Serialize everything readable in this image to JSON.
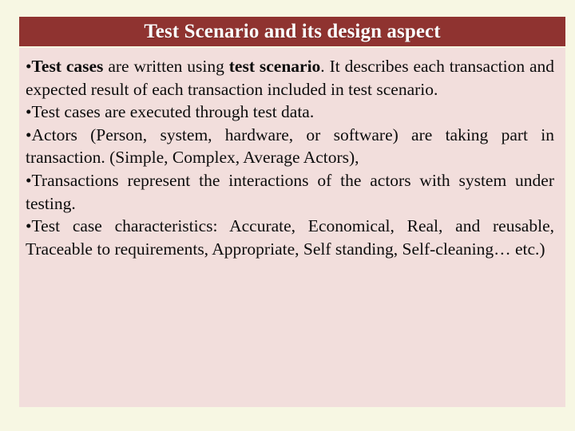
{
  "slide": {
    "background_color": "#f7f7e3",
    "title": {
      "text": "Test Scenario and its design aspect",
      "background_color": "#8f3330",
      "text_color": "#ffffff"
    },
    "content": {
      "background_color": "#f2dedc",
      "bullets": [
        {
          "id": "bullet-test-cases-written",
          "segments": [
            {
              "text": "Test cases",
              "bold": true
            },
            {
              "text": " are written using ",
              "bold": false
            },
            {
              "text": "test scenario",
              "bold": true
            },
            {
              "text": ". It describes each transaction and expected result of each transaction included in test scenario.",
              "bold": false
            }
          ],
          "plain": "Test cases are written using test scenario. It describes each transaction and expected result of each transaction included in test scenario."
        },
        {
          "id": "bullet-test-cases-executed",
          "segments": [
            {
              "text": "Test cases are executed through test data.",
              "bold": false
            }
          ],
          "plain": "Test cases are executed through test data."
        },
        {
          "id": "bullet-actors",
          "segments": [
            {
              "text": "Actors (Person, system, hardware, or software) are taking part in transaction. (Simple, Complex, Average Actors),",
              "bold": false
            }
          ],
          "plain": "Actors (Person, system, hardware, or software) are taking part in transaction. (Simple, Complex, Average Actors),"
        },
        {
          "id": "bullet-transactions",
          "segments": [
            {
              "text": "Transactions represent the interactions of the actors with system under testing.",
              "bold": false
            }
          ],
          "plain": "Transactions represent the interactions of the actors with system under testing."
        },
        {
          "id": "bullet-test-case-characteristics",
          "segments": [
            {
              "text": "Test case characteristics: Accurate, Economical, Real, and reusable, Traceable to requirements, Appropriate, Self standing, Self-cleaning… etc.)",
              "bold": false
            }
          ],
          "plain": "Test case characteristics: Accurate, Economical, Real, and reusable, Traceable to requirements, Appropriate, Self standing, Self-cleaning… etc.)"
        }
      ]
    }
  }
}
